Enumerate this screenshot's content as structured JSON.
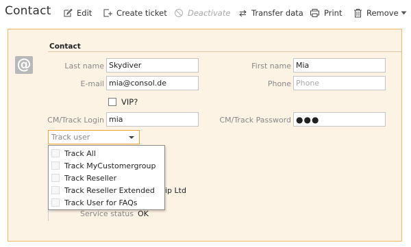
{
  "header": {
    "title": "Contact"
  },
  "toolbar": {
    "edit": "Edit",
    "create_ticket": "Create ticket",
    "deactivate": "Deactivate",
    "transfer_data": "Transfer data",
    "print": "Print",
    "remove": "Remove"
  },
  "section": {
    "title": "Contact",
    "icon": "at-icon"
  },
  "form": {
    "last_name": {
      "label": "Last name",
      "value": "Skydiver"
    },
    "first_name": {
      "label": "First name",
      "value": "Mia"
    },
    "email": {
      "label": "E-mail",
      "value": "mia@consol.de"
    },
    "phone": {
      "label": "Phone",
      "value": "",
      "placeholder": "Phone"
    },
    "vip": {
      "label": "VIP?",
      "checked": false
    },
    "cm_login": {
      "label": "CM/Track Login",
      "value": "mia"
    },
    "cm_password": {
      "label": "CM/Track Password",
      "value": "●●●"
    },
    "track_user": {
      "placeholder": "Track user"
    }
  },
  "track_user_options": [
    "Track All",
    "Track MyCustomergroup",
    "Track Reseller",
    "Track Reseller Extended",
    "Track User for FAQs"
  ],
  "partial": {
    "company_fragment": "ip Ltd",
    "service_status_label": "Service status",
    "service_status_value": "OK"
  },
  "colors": {
    "card_background": "#fdf3e5",
    "card_border": "#f0b665",
    "dropdown_focus": "#f0a030"
  }
}
